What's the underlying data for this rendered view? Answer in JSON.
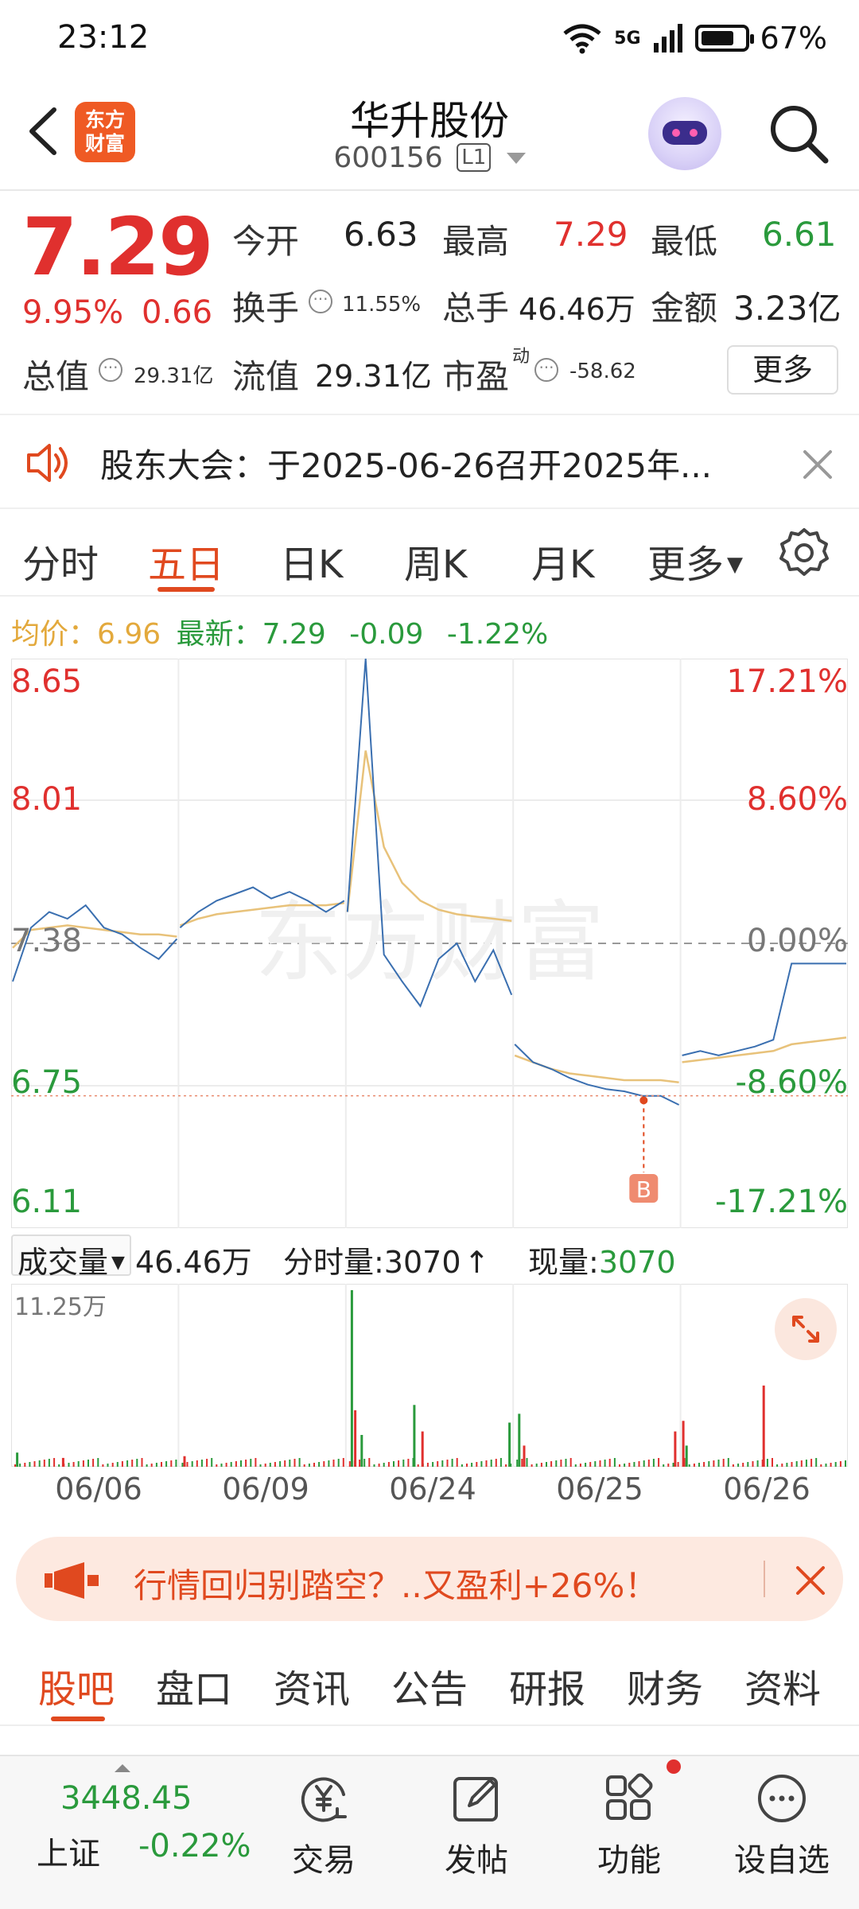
{
  "status_bar": {
    "time": "23:12",
    "network": "5G",
    "battery": "67%"
  },
  "header": {
    "logo_text": "东方财富",
    "stock_name": "华升股份",
    "stock_code": "600156",
    "level_badge": "L1"
  },
  "quote": {
    "price": "7.29",
    "change_pct": "9.95%",
    "change": "0.66",
    "fields": {
      "open_label": "今开",
      "open": "6.63",
      "high_label": "最高",
      "high": "7.29",
      "low_label": "最低",
      "low": "6.61",
      "turnover_label": "换手",
      "turnover": "11.55%",
      "volume_label": "总手",
      "volume": "46.46万",
      "amount_label": "金额",
      "amount": "3.23亿",
      "mktcap_label": "总值",
      "mktcap": "29.31亿",
      "float_label": "流值",
      "float": "29.31亿",
      "pe_label": "市盈",
      "pe_sup": "动",
      "pe": "-58.62"
    },
    "more_label": "更多"
  },
  "notice": {
    "text": "股东大会：于2025-06-26召开2025年..."
  },
  "chart_tabs": [
    {
      "label": "分时"
    },
    {
      "label": "五日"
    },
    {
      "label": "日K"
    },
    {
      "label": "周K"
    },
    {
      "label": "月K"
    },
    {
      "label": "更多"
    }
  ],
  "avg_line": {
    "avg_label": "均价：",
    "avg_value": "6.96",
    "latest_label": "最新：",
    "latest_value": "7.29",
    "change": "-0.09",
    "change_pct": "-1.22%"
  },
  "watermark": "东方财富",
  "chart_data": {
    "type": "line",
    "title": "",
    "y_left_ticks": [
      "8.65",
      "8.01",
      "7.38",
      "6.75",
      "6.11"
    ],
    "y_right_ticks": [
      "17.21%",
      "8.60%",
      "0.00%",
      "-8.60%",
      "-17.21%"
    ],
    "x_labels": [
      "06/06",
      "06/09",
      "06/24",
      "06/25",
      "06/26"
    ],
    "ylim": [
      6.11,
      8.65
    ],
    "prev_close": 7.38,
    "buy_marker": {
      "label": "B",
      "day": "06/25",
      "price": 6.68
    },
    "series": [
      {
        "name": "价格",
        "color": "#3a6fb0",
        "days": [
          [
            7.21,
            7.45,
            7.52,
            7.49,
            7.55,
            7.45,
            7.42,
            7.36,
            7.31,
            7.4
          ],
          [
            7.45,
            7.52,
            7.57,
            7.6,
            7.63,
            7.58,
            7.61,
            7.57,
            7.52,
            7.57
          ],
          [
            7.52,
            8.65,
            7.33,
            7.21,
            7.1,
            7.31,
            7.38,
            7.21,
            7.35,
            7.15
          ],
          [
            6.93,
            6.85,
            6.82,
            6.78,
            6.75,
            6.73,
            6.72,
            6.7,
            6.7,
            6.66
          ],
          [
            6.88,
            6.9,
            6.88,
            6.9,
            6.92,
            6.95,
            7.29,
            7.29,
            7.29,
            7.29
          ]
        ]
      },
      {
        "name": "均价",
        "color": "#e8c27a",
        "days": [
          [
            7.36,
            7.44,
            7.45,
            7.46,
            7.45,
            7.44,
            7.43,
            7.42,
            7.42,
            7.41
          ],
          [
            7.46,
            7.49,
            7.51,
            7.52,
            7.53,
            7.54,
            7.55,
            7.55,
            7.55,
            7.56
          ],
          [
            7.52,
            8.24,
            7.81,
            7.65,
            7.57,
            7.53,
            7.51,
            7.5,
            7.49,
            7.48
          ],
          [
            6.88,
            6.85,
            6.82,
            6.8,
            6.79,
            6.78,
            6.77,
            6.77,
            6.77,
            6.76
          ],
          [
            6.85,
            6.86,
            6.87,
            6.88,
            6.89,
            6.9,
            6.93,
            6.94,
            6.95,
            6.96
          ]
        ]
      }
    ],
    "volume": {
      "max_label": "11.25万",
      "spikes": [
        {
          "day": 0,
          "pos": 0.02,
          "value": 0.08,
          "color": "#2a9a3c"
        },
        {
          "day": 0,
          "pos": 0.3,
          "value": 0.05,
          "color": "#e0302e"
        },
        {
          "day": 1,
          "pos": 0.02,
          "value": 0.06,
          "color": "#e0302e"
        },
        {
          "day": 2,
          "pos": 0.02,
          "value": 1.0,
          "color": "#2a9a3c"
        },
        {
          "day": 2,
          "pos": 0.04,
          "value": 0.32,
          "color": "#e0302e"
        },
        {
          "day": 2,
          "pos": 0.08,
          "value": 0.18,
          "color": "#2a9a3c"
        },
        {
          "day": 2,
          "pos": 0.4,
          "value": 0.35,
          "color": "#2a9a3c"
        },
        {
          "day": 2,
          "pos": 0.45,
          "value": 0.2,
          "color": "#e0302e"
        },
        {
          "day": 2,
          "pos": 0.98,
          "value": 0.25,
          "color": "#2a9a3c"
        },
        {
          "day": 3,
          "pos": 0.02,
          "value": 0.3,
          "color": "#2a9a3c"
        },
        {
          "day": 3,
          "pos": 0.05,
          "value": 0.12,
          "color": "#e0302e"
        },
        {
          "day": 3,
          "pos": 0.97,
          "value": 0.2,
          "color": "#e0302e"
        },
        {
          "day": 4,
          "pos": 0.0,
          "value": 0.26,
          "color": "#e0302e"
        },
        {
          "day": 4,
          "pos": 0.02,
          "value": 0.12,
          "color": "#2a9a3c"
        },
        {
          "day": 4,
          "pos": 0.49,
          "value": 0.46,
          "color": "#e0302e"
        }
      ]
    }
  },
  "volume_header": {
    "type_label": "成交量",
    "total": "46.46万",
    "tick_label": "分时量:3070",
    "now_label": "现量:",
    "now_value": "3070"
  },
  "ad": {
    "text": "行情回归别踏空？..又盈利+26%！"
  },
  "content_tabs": [
    {
      "label": "股吧"
    },
    {
      "label": "盘口"
    },
    {
      "label": "资讯"
    },
    {
      "label": "公告"
    },
    {
      "label": "研报"
    },
    {
      "label": "财务"
    },
    {
      "label": "资料"
    }
  ],
  "bottom_nav": {
    "index_value": "3448.45",
    "index_name": "上证",
    "index_pct": "-0.22%",
    "items": [
      {
        "label": "交易"
      },
      {
        "label": "发帖"
      },
      {
        "label": "功能"
      },
      {
        "label": "设自选"
      }
    ]
  },
  "colors": {
    "up": "#e0302e",
    "down": "#2a9a3c",
    "accent": "#e0491f",
    "avg": "#e3a93c"
  }
}
